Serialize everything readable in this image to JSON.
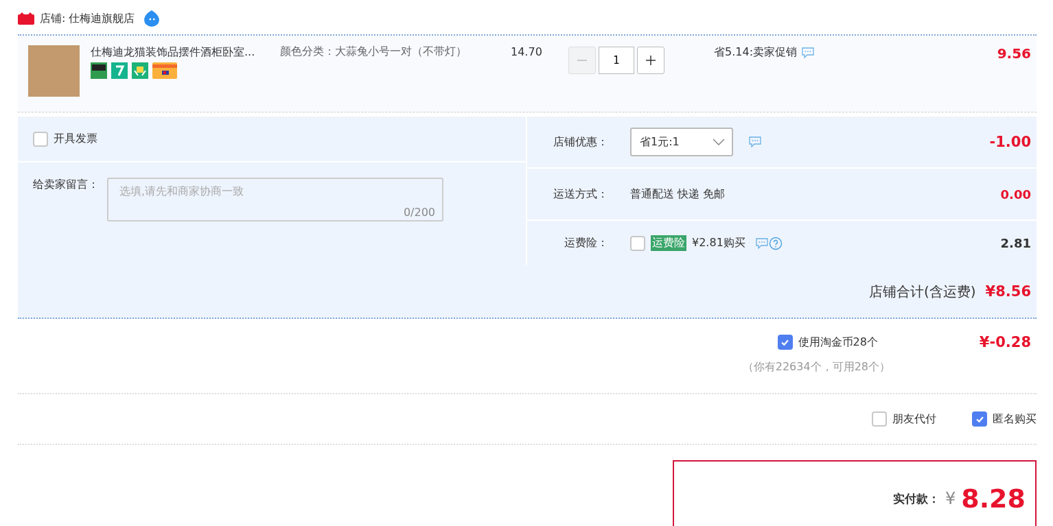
{
  "store": {
    "label": "店铺: 仕梅迪旗舰店"
  },
  "item": {
    "title": "仕梅迪龙猫装饰品摆件酒柜卧室...",
    "spec": "颜色分类：大蒜兔小号一对（不带灯）",
    "price": "14.70",
    "quantity": "1",
    "promo": "省5.14:卖家促销",
    "total": "9.56"
  },
  "invoice": {
    "label": "开具发票",
    "checked": false
  },
  "message": {
    "label": "给卖家留言：",
    "placeholder": "选填,请先和商家协商一致",
    "counter": "0/200"
  },
  "discount": {
    "label": "店铺优惠：",
    "value": "省1元:1",
    "amount": "-1.00"
  },
  "shipping": {
    "label": "运送方式：",
    "value": "普通配送 快递 免邮",
    "amount": "0.00"
  },
  "insurance": {
    "label": "运费险：",
    "checked": false,
    "tag": "运费险",
    "price": "¥2.81购买",
    "amount": "2.81"
  },
  "store_total": {
    "label": "店铺合计(含运费)",
    "amount": "¥8.56"
  },
  "coins": {
    "label": "使用淘金币28个",
    "checked": true,
    "amount": "¥-0.28",
    "note": "（你有22634个，可用28个）"
  },
  "options": [
    {
      "label": "朋友代付",
      "checked": false
    },
    {
      "label": "匿名购买",
      "checked": true
    }
  ],
  "payment": {
    "label": "实付款：",
    "currency": "¥",
    "amount": "8.28"
  }
}
